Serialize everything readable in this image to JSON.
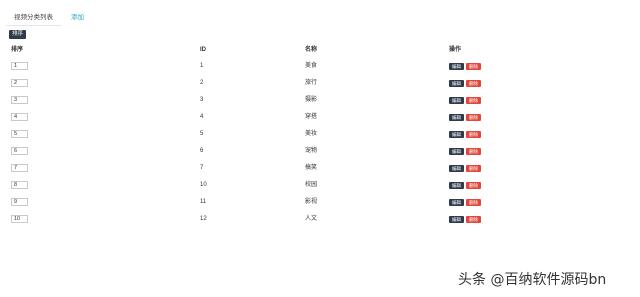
{
  "tabs": [
    {
      "label": "视频分类列表"
    },
    {
      "label": "添加"
    }
  ],
  "sort_button": "排序",
  "columns": {
    "sort": "排序",
    "id": "ID",
    "name": "名称",
    "action": "操作"
  },
  "actions": {
    "edit": "编辑",
    "delete": "删除"
  },
  "rows": [
    {
      "sort": "1",
      "id": "1",
      "name": "美食"
    },
    {
      "sort": "2",
      "id": "2",
      "name": "旅行"
    },
    {
      "sort": "3",
      "id": "3",
      "name": "摄影"
    },
    {
      "sort": "4",
      "id": "4",
      "name": "穿搭"
    },
    {
      "sort": "5",
      "id": "5",
      "name": "美妆"
    },
    {
      "sort": "6",
      "id": "6",
      "name": "宠物"
    },
    {
      "sort": "7",
      "id": "7",
      "name": "搞笑"
    },
    {
      "sort": "8",
      "id": "10",
      "name": "校园"
    },
    {
      "sort": "9",
      "id": "11",
      "name": "影视"
    },
    {
      "sort": "10",
      "id": "12",
      "name": "人文"
    }
  ],
  "watermark": "头条 @百纳软件源码bn"
}
